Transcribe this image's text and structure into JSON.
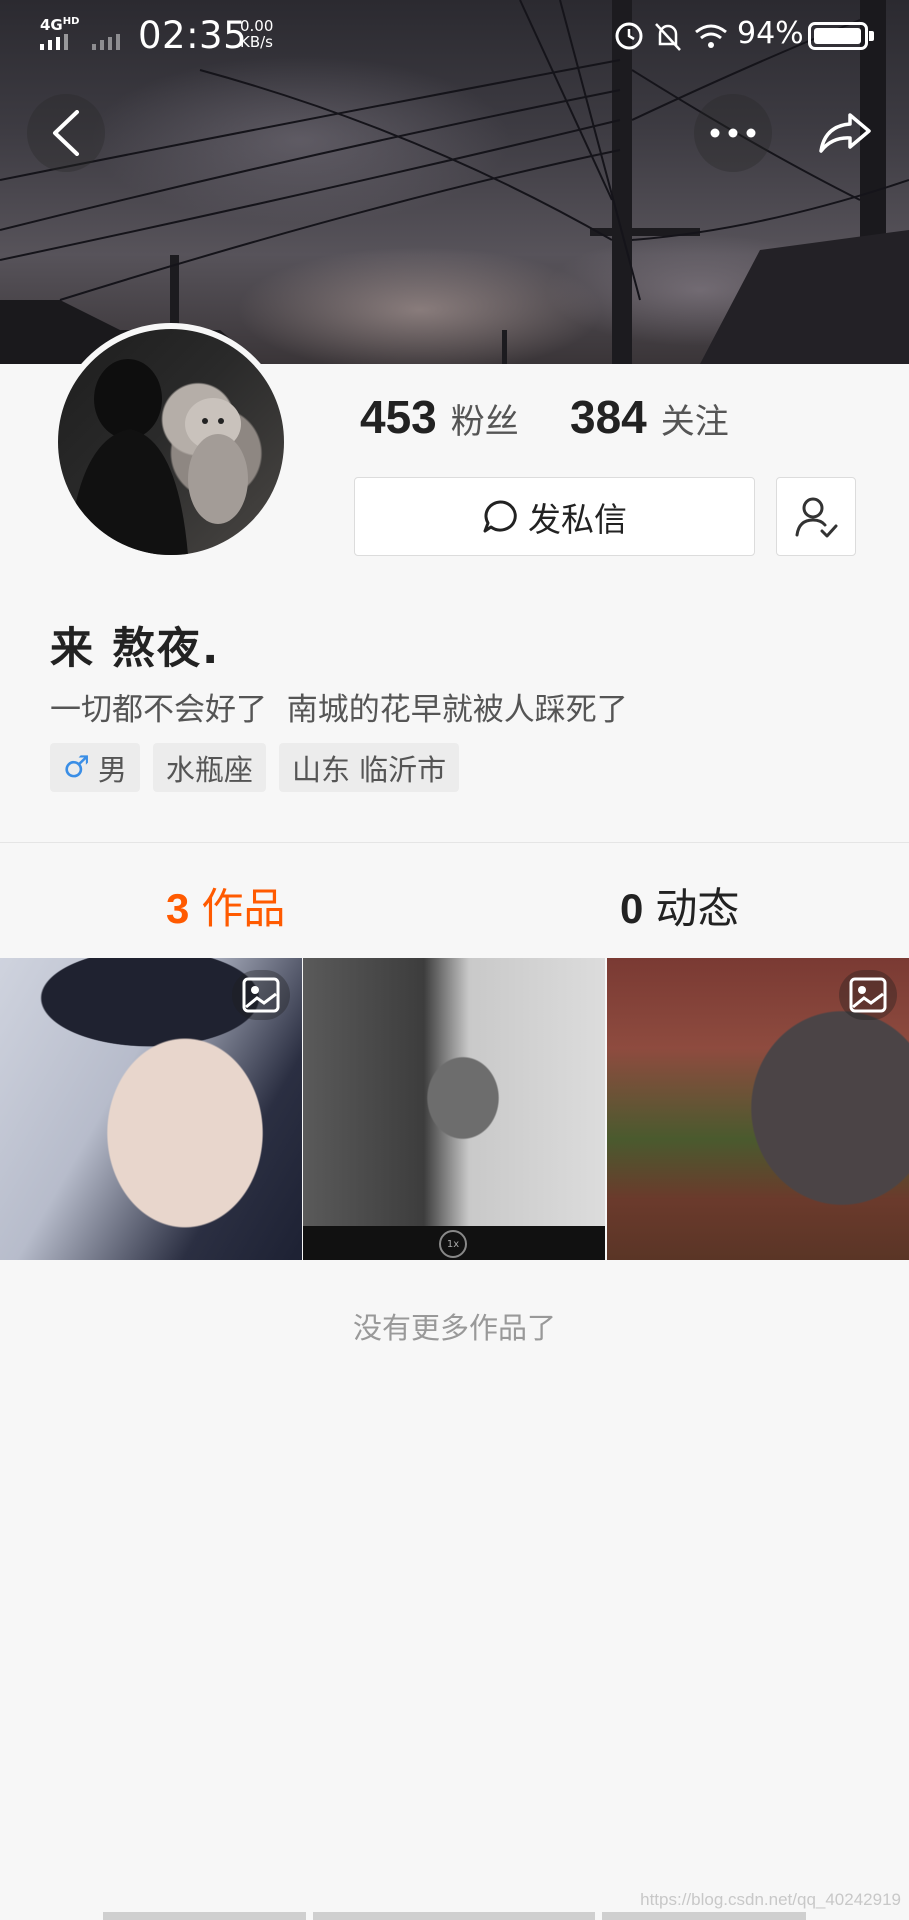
{
  "status_bar": {
    "network": "4G",
    "network_suffix": "HD",
    "time": "02:35",
    "speed_value": "0.00",
    "speed_unit": "KB/s",
    "battery": "94%",
    "icons": [
      "signal-icon",
      "alarm-icon",
      "mute-bell-icon",
      "wifi-icon",
      "battery-icon"
    ]
  },
  "profile": {
    "fans_count": "453",
    "fans_label": "粉丝",
    "following_count": "384",
    "following_label": "关注",
    "message_button": "发私信",
    "nickname": "来 熬夜.",
    "bio": "一切都不会好了  南城的花早就被人踩死了",
    "tags": {
      "gender_symbol": "♂",
      "gender": "男",
      "zodiac": "水瓶座",
      "location": "山东 临沂市"
    }
  },
  "tabs": {
    "works_count": "3",
    "works_label": "作品",
    "moments_count": "0",
    "moments_label": "动态",
    "active": "works"
  },
  "grid": {
    "speed_badge": "1x"
  },
  "footer": {
    "no_more": "没有更多作品了",
    "watermark": "https://blog.csdn.net/qq_40242919"
  },
  "colors": {
    "accent": "#ff5a00",
    "male_blue": "#3a8ee6",
    "background": "#f7f7f7"
  }
}
